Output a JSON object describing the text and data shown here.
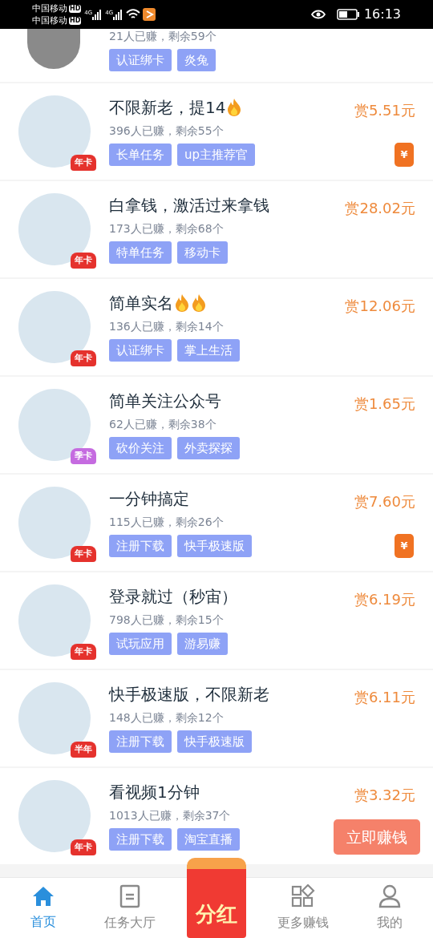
{
  "status_bar": {
    "carriers": [
      {
        "name": "中国移动",
        "tag": "HD"
      },
      {
        "name": "中国移动",
        "tag": "HD"
      }
    ],
    "network": [
      "4G",
      "4G"
    ],
    "time": "16:13"
  },
  "partial_task": {
    "stats": "21人已赚，剩余59个",
    "tags": [
      "认证绑卡",
      "炎兔"
    ]
  },
  "tasks": [
    {
      "title": "不限新老，提14",
      "flames": [
        {
          "kind": "fire"
        }
      ],
      "stats": "396人已赚，剩余55个",
      "tags": [
        "长单任务",
        "up主推荐官"
      ],
      "reward": "赏5.51元",
      "badge": {
        "text": "年卡",
        "color": "#e5322d"
      },
      "coupon": "¥"
    },
    {
      "title": "白拿钱，激活过来拿钱",
      "stats": "173人已赚，剩余68个",
      "tags": [
        "特单任务",
        "移动卡"
      ],
      "reward": "赏28.02元",
      "badge": {
        "text": "年卡",
        "color": "#e5322d"
      }
    },
    {
      "title": "简单实名",
      "flames": [
        {
          "kind": "fire"
        },
        {
          "kind": "fire"
        }
      ],
      "stats": "136人已赚，剩余14个",
      "tags": [
        "认证绑卡",
        "掌上生活"
      ],
      "reward": "赏12.06元",
      "badge": {
        "text": "年卡",
        "color": "#e5322d"
      }
    },
    {
      "title": "简单关注公众号",
      "stats": "62人已赚，剩余38个",
      "tags": [
        "砍价关注",
        "外卖探探"
      ],
      "reward": "赏1.65元",
      "badge": {
        "text": "季卡",
        "color": "#c56be0"
      }
    },
    {
      "title": "一分钟搞定",
      "stats": "115人已赚，剩余26个",
      "tags": [
        "注册下载",
        "快手极速版"
      ],
      "reward": "赏7.60元",
      "badge": {
        "text": "年卡",
        "color": "#e5322d"
      },
      "coupon": "¥"
    },
    {
      "title": "登录就过（秒宙）",
      "stats": "798人已赚，剩余15个",
      "tags": [
        "试玩应用",
        "游易赚"
      ],
      "reward": "赏6.19元",
      "badge": {
        "text": "年卡",
        "color": "#e5322d"
      }
    },
    {
      "title": "快手极速版，不限新老",
      "stats": "148人已赚，剩余12个",
      "tags": [
        "注册下载",
        "快手极速版"
      ],
      "reward": "赏6.11元",
      "badge": {
        "text": "半年",
        "color": "#e5322d"
      }
    },
    {
      "title": "看视频1分钟",
      "stats": "1013人已赚，剩余37个",
      "tags": [
        "注册下载",
        "淘宝直播"
      ],
      "reward": "赏3.32元",
      "badge": {
        "text": "年卡",
        "color": "#e5322d"
      }
    }
  ],
  "float_button": "立即赚钱",
  "center_button": "分红",
  "nav": [
    {
      "kind": "home",
      "label": "首页",
      "selected": true
    },
    {
      "kind": "list",
      "label": "任务大厅",
      "selected": false
    },
    {
      "kind": "grid",
      "label": "更多赚钱",
      "selected": false
    },
    {
      "kind": "person",
      "label": "我的",
      "selected": false
    }
  ]
}
